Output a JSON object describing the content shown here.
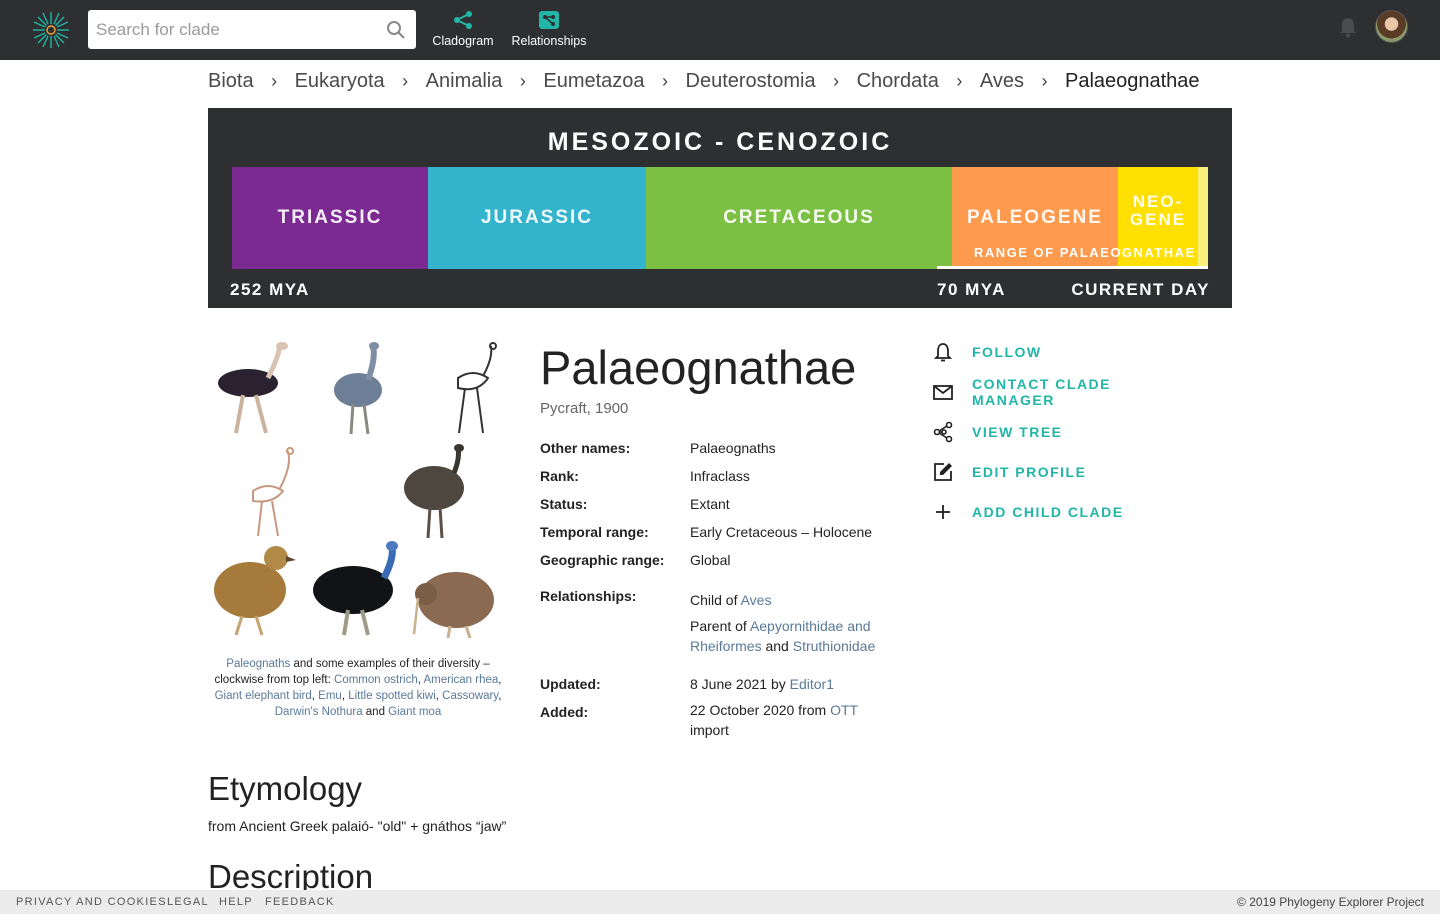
{
  "header": {
    "search_placeholder": "Search for clade",
    "nav": [
      {
        "label": "Cladogram",
        "icon": "share-nodes-icon"
      },
      {
        "label": "Relationships",
        "icon": "relationships-icon"
      }
    ],
    "accent_color": "#21b6a8",
    "bar_color": "#2d2f31"
  },
  "breadcrumb": [
    "Biota",
    "Eukaryota",
    "Animalia",
    "Eumetazoa",
    "Deuterostomia",
    "Chordata",
    "Aves",
    "Palaeognathae"
  ],
  "timeline": {
    "title": "MESOZOIC - CENOZOIC",
    "periods": [
      {
        "name": "TRIASSIC",
        "color": "#7b2a92"
      },
      {
        "name": "JURASSIC",
        "color": "#33b3cc"
      },
      {
        "name": "CRETACEOUS",
        "color": "#7bc043"
      },
      {
        "name": "PALEOGENE",
        "color": "#fd9a4e"
      },
      {
        "name": "NEO-\nGENE",
        "color": "#ffe000"
      },
      {
        "name": "",
        "color": "#f8f07a"
      }
    ],
    "range_label": "RANGE OF PALAEOGNATHAE",
    "start_label": "252 MYA",
    "range_start_label": "70 MYA",
    "end_label": "CURRENT DAY"
  },
  "clade": {
    "name": "Palaeognathae",
    "authority": "Pycraft, 1900",
    "facts": {
      "other_names": {
        "label": "Other names:",
        "value": "Palaeognaths"
      },
      "rank": {
        "label": "Rank:",
        "value": "Infraclass"
      },
      "status": {
        "label": "Status:",
        "value": "Extant"
      },
      "temporal_range": {
        "label": "Temporal range:",
        "value": "Early Cretaceous – Holocene"
      },
      "geographic_range": {
        "label": "Geographic range:",
        "value": "Global"
      },
      "relationships": {
        "label": "Relationships:",
        "child_prefix": "Child of ",
        "child_of": "Aves",
        "parent_prefix": "Parent of ",
        "parent_of_1": "Aepyornithidae and Rheiformes",
        "parent_and": " and ",
        "parent_of_2": "Struthionidae"
      },
      "updated": {
        "label": "Updated:",
        "prefix": "8 June 2021 by ",
        "by": "Editor1"
      },
      "added": {
        "label": "Added:",
        "prefix": "22 October 2020 from ",
        "source": "OTT",
        "suffix": " import"
      }
    }
  },
  "image_caption": {
    "lead_link": "Paleognaths",
    "lead_text": " and some examples of their diversity – clockwise from top left: ",
    "links": [
      "Common ostrich",
      "American rhea",
      "Giant elephant bird",
      "Emu",
      "Little spotted kiwi",
      "Cassowary",
      "Darwin's Nothura",
      "Giant moa"
    ],
    "and_word": " and "
  },
  "actions": [
    {
      "label": "FOLLOW",
      "icon": "bell-icon"
    },
    {
      "label": "CONTACT CLADE MANAGER",
      "icon": "mail-icon"
    },
    {
      "label": "VIEW TREE",
      "icon": "share-nodes-icon"
    },
    {
      "label": "EDIT PROFILE",
      "icon": "edit-icon"
    },
    {
      "label": "ADD CHILD CLADE",
      "icon": "plus-icon"
    }
  ],
  "etymology": {
    "heading": "Etymology",
    "text": "from Ancient Greek palaió- \"old\" + gnáthos “jaw”"
  },
  "description": {
    "heading": "Description"
  },
  "footer": {
    "links": [
      "PRIVACY AND COOKIES",
      "LEGAL",
      "HELP",
      "FEEDBACK"
    ],
    "copyright": "© 2019 Phylogeny Explorer Project"
  }
}
